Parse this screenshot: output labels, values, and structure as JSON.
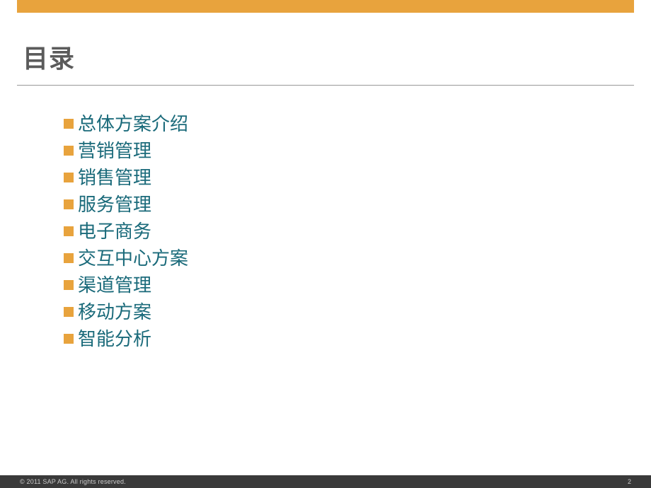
{
  "title": "目录",
  "toc": [
    "总体方案介绍",
    "营销管理",
    "销售管理",
    "服务管理",
    "电子商务",
    "交互中心方案",
    "渠道管理",
    "移动方案",
    "智能分析"
  ],
  "footer": {
    "copyright": "©  2011 SAP AG. All rights reserved.",
    "page": "2"
  },
  "colors": {
    "accent": "#e8a33d",
    "toc_text": "#1a6a7a",
    "title_text": "#5b5b5b",
    "footer_bg": "#3a3a3a"
  }
}
